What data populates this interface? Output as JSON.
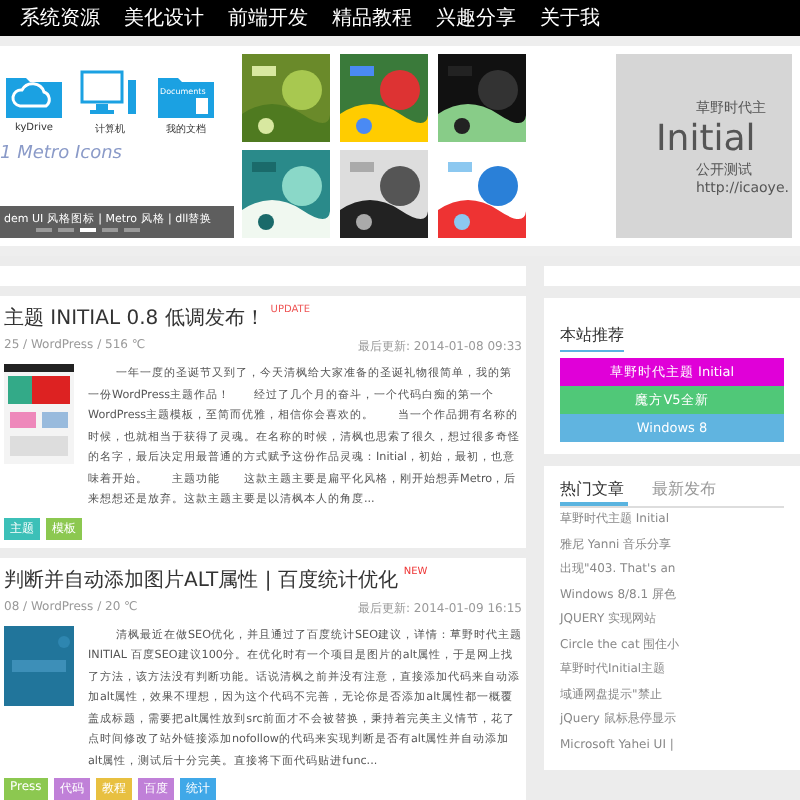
{
  "nav": {
    "items": [
      {
        "label": "系统资源",
        "selected": false
      },
      {
        "label": "美化设计",
        "selected": false
      },
      {
        "label": "前端开发",
        "selected": false
      },
      {
        "label": "精品教程",
        "selected": false
      },
      {
        "label": "兴趣分享",
        "selected": false
      },
      {
        "label": "关于我",
        "selected": false
      }
    ]
  },
  "slider": {
    "icons": [
      {
        "kind": "cloud",
        "label": "kyDrive"
      },
      {
        "kind": "monitor",
        "label": "计算机"
      },
      {
        "kind": "folder",
        "label": "我的文档",
        "badge": "Documents"
      }
    ],
    "heading": "1 Metro Icons",
    "caption": "dem UI 风格图标 | Metro 风格 | dll替换",
    "dots": [
      {
        "selected": false
      },
      {
        "selected": false
      },
      {
        "selected": true
      },
      {
        "selected": false
      },
      {
        "selected": false
      }
    ]
  },
  "banner": {
    "line_1": "草野时代主",
    "title": "Initial",
    "line_2": "公开测试",
    "url": "http://icaoye."
  },
  "posts": [
    {
      "title": "主题 INITIAL 0.8 低调发布！",
      "flag": "UPDATE",
      "meta": "25 / WordPress / 516 ℃",
      "updated": "最后更新: 2014-01-08 09:33",
      "excerpt": "一年一度的圣诞节又到了，今天清枫给大家准备的圣诞礼物很简单，我的第一份WordPress主题作品！　　经过了几个月的奋斗，一个代码白痴的第一个WordPress主题模板，至简而优雅，相信你会喜欢的。　　当一个作品拥有名称的时候，也就相当于获得了灵魂。在名称的时候，清枫也思索了很久，想过很多奇怪的名字，最后决定用最普通的方式赋予这份作品灵魂：Initial，初始，最初，也意味着开始。　　主题功能　　这款主题主要是扁平化风格，刚开始想弄Metro，后来想想还是放弃。这款主题主要是以清枫本人的角度...",
      "tags": [
        {
          "label": "主题",
          "color": "#3cc0b8"
        },
        {
          "label": "模板",
          "color": "#8cc850"
        }
      ]
    },
    {
      "title": "判断并自动添加图片ALT属性 | 百度统计优化",
      "flag": "NEW",
      "meta": "08 / WordPress / 20 ℃",
      "updated": "最后更新: 2014-01-09 16:15",
      "excerpt": "清枫最近在做SEO优化，并且通过了百度统计SEO建议，详情：草野时代主题 INITIAL 百度SEO建议100分。在优化时有一个项目是图片的alt属性，于是网上找了方法，该方法没有判断功能。话说清枫之前并没有注意，直接添加代码来自动添加alt属性，效果不理想，因为这个代码不完善，无论你是否添加alt属性都一概覆盖成标题，需要把alt属性放到src前面才不会被替换，秉持着完美主义情节，花了点时间修改了站外链接添加nofollow的代码来实现判断是否有alt属性并自动添加alt属性，测试后十分完美。直接将下面代码贴进func...",
      "tags": [
        {
          "label": "Press",
          "color": "#8cc850"
        },
        {
          "label": "代码",
          "color": "#c080d8"
        },
        {
          "label": "教程",
          "color": "#e8c040"
        },
        {
          "label": "百度",
          "color": "#c080d8"
        },
        {
          "label": "统计",
          "color": "#40a8e8"
        }
      ]
    }
  ],
  "sidebar": {
    "recommend": {
      "title": "本站推荐",
      "links": [
        {
          "label": "草野时代主题 Initial",
          "color": "#e000d8"
        },
        {
          "label": "魔方V5全新",
          "color": "#50c878"
        },
        {
          "label": "Windows 8",
          "color": "#60b4e0"
        }
      ]
    },
    "tabs": [
      {
        "label": "热门文章",
        "selected": true
      },
      {
        "label": "最新发布",
        "selected": false
      }
    ],
    "list": [
      "草野时代主题 Initial",
      "雅尼 Yanni 音乐分享",
      "出现\"403. That's an",
      "Windows 8/8.1 屏色",
      "JQUERY 实现网站",
      "Circle the cat 围住小",
      "草野时代Initial主题",
      "域通网盘提示\"禁止",
      "jQuery 鼠标悬停显示",
      "Microsoft Yahei UI |"
    ]
  }
}
